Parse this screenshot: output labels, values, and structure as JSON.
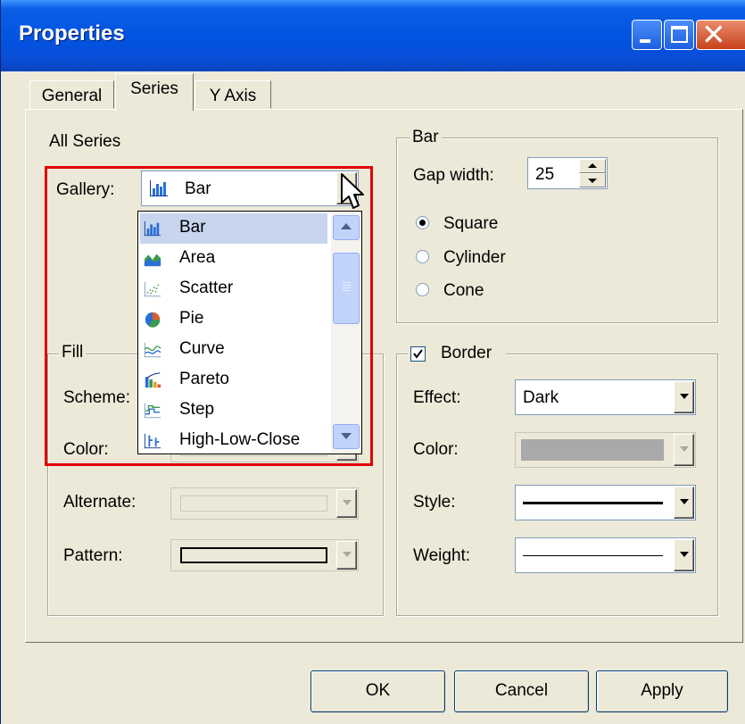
{
  "window": {
    "title": "Properties"
  },
  "tabs": [
    {
      "label": "General"
    },
    {
      "label": "Series"
    },
    {
      "label": "Y Axis"
    }
  ],
  "all_series": {
    "heading": "All Series",
    "gallery_label": "Gallery:",
    "gallery_value": "Bar",
    "gallery_options": [
      {
        "label": "Bar",
        "icon": "bar-chart-icon"
      },
      {
        "label": "Area",
        "icon": "area-chart-icon"
      },
      {
        "label": "Scatter",
        "icon": "scatter-chart-icon"
      },
      {
        "label": "Pie",
        "icon": "pie-chart-icon"
      },
      {
        "label": "Curve",
        "icon": "curve-chart-icon"
      },
      {
        "label": "Pareto",
        "icon": "pareto-chart-icon"
      },
      {
        "label": "Step",
        "icon": "step-chart-icon"
      },
      {
        "label": "High-Low-Close",
        "icon": "high-low-close-chart-icon"
      }
    ]
  },
  "fill": {
    "title": "Fill",
    "scheme_label": "Scheme:",
    "color_label": "Color:",
    "alternate_label": "Alternate:",
    "pattern_label": "Pattern:"
  },
  "bar": {
    "title": "Bar",
    "gap_width_label": "Gap width:",
    "gap_width_value": "25",
    "shapes": [
      {
        "label": "Square",
        "checked": true
      },
      {
        "label": "Cylinder",
        "checked": false
      },
      {
        "label": "Cone",
        "checked": false
      }
    ]
  },
  "border": {
    "title": "Border",
    "checked": true,
    "effect_label": "Effect:",
    "effect_value": "Dark",
    "color_label": "Color:",
    "style_label": "Style:",
    "weight_label": "Weight:"
  },
  "buttons": {
    "ok": "OK",
    "cancel": "Cancel",
    "apply": "Apply"
  },
  "colors": {
    "title_bar": "#0153e0",
    "dialog_bg": "#ece9d8",
    "highlight_box": "#e00000",
    "selection": "#c7d6ee"
  }
}
